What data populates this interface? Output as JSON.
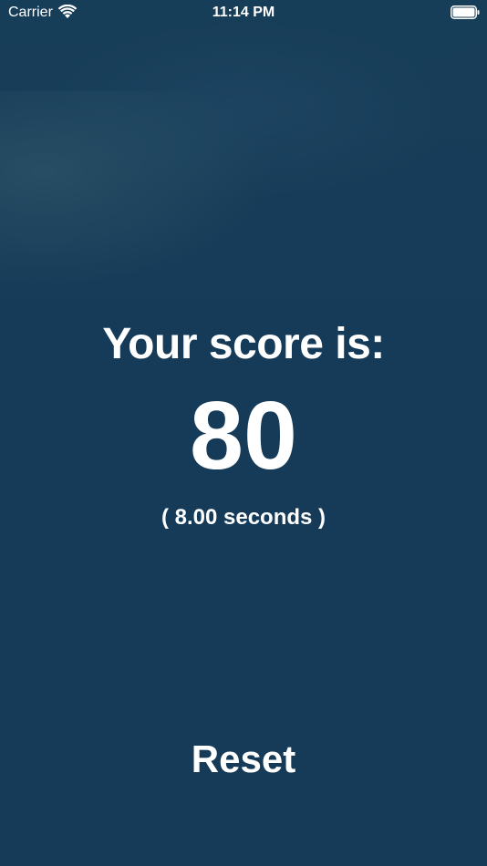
{
  "status_bar": {
    "carrier": "Carrier",
    "time": "11:14 PM",
    "wifi_icon": "wifi-icon",
    "battery_icon": "battery-icon"
  },
  "score": {
    "heading": "Your score is:",
    "value": "80",
    "time": "( 8.00 seconds )"
  },
  "actions": {
    "reset_label": "Reset"
  },
  "colors": {
    "background": "#163b59",
    "text": "#ffffff"
  }
}
